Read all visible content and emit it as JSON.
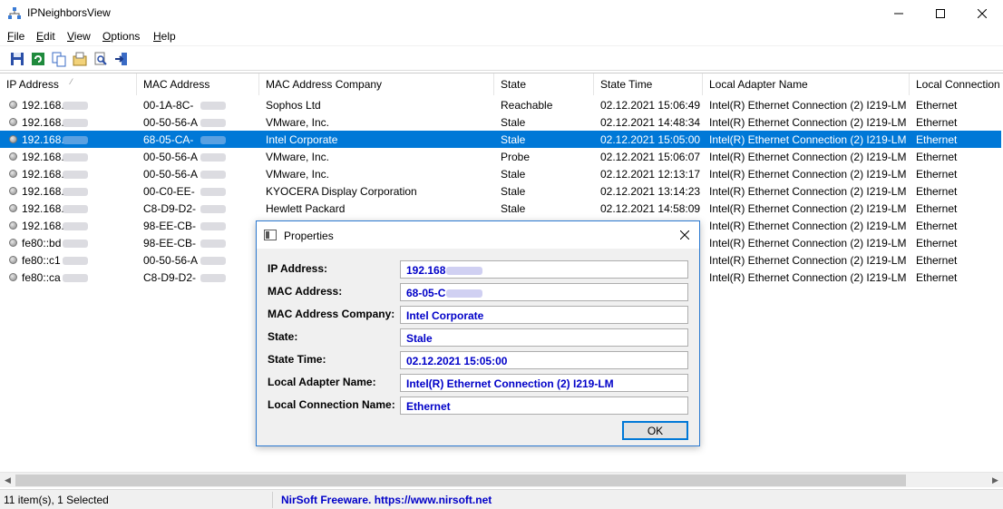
{
  "window": {
    "title": "IPNeighborsView"
  },
  "menu": [
    {
      "label": "File",
      "key": "F",
      "rest": "ile"
    },
    {
      "label": "Edit",
      "key": "E",
      "rest": "dit"
    },
    {
      "label": "View",
      "key": "V",
      "rest": "iew"
    },
    {
      "label": "Options",
      "key": "O",
      "rest": "ptions"
    },
    {
      "label": "Help",
      "key": "H",
      "rest": "elp"
    }
  ],
  "toolbar": [
    "save-icon",
    "refresh-icon",
    "copy-icon",
    "properties-icon",
    "find-icon",
    "exit-icon"
  ],
  "columns": [
    "IP Address",
    "MAC Address",
    "MAC Address Company",
    "State",
    "State Time",
    "Local Adapter Name",
    "Local Connection"
  ],
  "rows": [
    {
      "ip": "192.168.",
      "mac": "00-1A-8C-",
      "company": "Sophos Ltd",
      "state": "Reachable",
      "time": "02.12.2021 15:06:49",
      "adapter": "Intel(R) Ethernet Connection (2) I219-LM",
      "conn": "Ethernet"
    },
    {
      "ip": "192.168.",
      "mac": "00-50-56-A",
      "company": "VMware, Inc.",
      "state": "Stale",
      "time": "02.12.2021 14:48:34",
      "adapter": "Intel(R) Ethernet Connection (2) I219-LM",
      "conn": "Ethernet"
    },
    {
      "ip": "192.168.",
      "mac": "68-05-CA-",
      "company": "Intel Corporate",
      "state": "Stale",
      "time": "02.12.2021 15:05:00",
      "adapter": "Intel(R) Ethernet Connection (2) I219-LM",
      "conn": "Ethernet",
      "selected": true
    },
    {
      "ip": "192.168.",
      "mac": "00-50-56-A",
      "company": "VMware, Inc.",
      "state": "Probe",
      "time": "02.12.2021 15:06:07",
      "adapter": "Intel(R) Ethernet Connection (2) I219-LM",
      "conn": "Ethernet"
    },
    {
      "ip": "192.168.",
      "mac": "00-50-56-A",
      "company": "VMware, Inc.",
      "state": "Stale",
      "time": "02.12.2021 12:13:17",
      "adapter": "Intel(R) Ethernet Connection (2) I219-LM",
      "conn": "Ethernet"
    },
    {
      "ip": "192.168.",
      "mac": "00-C0-EE-",
      "company": "KYOCERA Display Corporation",
      "state": "Stale",
      "time": "02.12.2021 13:14:23",
      "adapter": "Intel(R) Ethernet Connection (2) I219-LM",
      "conn": "Ethernet"
    },
    {
      "ip": "192.168.",
      "mac": "C8-D9-D2-",
      "company": "Hewlett Packard",
      "state": "Stale",
      "time": "02.12.2021 14:58:09",
      "adapter": "Intel(R) Ethernet Connection (2) I219-LM",
      "conn": "Ethernet"
    },
    {
      "ip": "192.168.",
      "mac": "98-EE-CB-",
      "company": "",
      "state": "",
      "time": "",
      "adapter": "Intel(R) Ethernet Connection (2) I219-LM",
      "conn": "Ethernet"
    },
    {
      "ip": "fe80::bd",
      "mac": "98-EE-CB-",
      "company": "",
      "state": "",
      "time": "",
      "adapter": "Intel(R) Ethernet Connection (2) I219-LM",
      "conn": "Ethernet"
    },
    {
      "ip": "fe80::c1",
      "mac": "00-50-56-A",
      "company": "",
      "state": "",
      "time": "",
      "adapter": "Intel(R) Ethernet Connection (2) I219-LM",
      "conn": "Ethernet"
    },
    {
      "ip": "fe80::ca",
      "mac": "C8-D9-D2-",
      "company": "",
      "state": "",
      "time": "",
      "adapter": "Intel(R) Ethernet Connection (2) I219-LM",
      "conn": "Ethernet"
    }
  ],
  "status": {
    "count": "11 item(s), 1 Selected",
    "link": "NirSoft Freeware. https://www.nirsoft.net"
  },
  "dialog": {
    "title": "Properties",
    "fields": [
      {
        "label": "IP Address:",
        "value": "192.168"
      },
      {
        "label": "MAC Address:",
        "value": "68-05-C"
      },
      {
        "label": "MAC Address Company:",
        "value": "Intel Corporate"
      },
      {
        "label": "State:",
        "value": "Stale"
      },
      {
        "label": "State Time:",
        "value": "02.12.2021 15:05:00"
      },
      {
        "label": "Local Adapter Name:",
        "value": "Intel(R) Ethernet Connection (2) I219-LM"
      },
      {
        "label": "Local Connection Name:",
        "value": "Ethernet"
      }
    ],
    "ok_label": "OK"
  },
  "colors": {
    "selection": "#0078d7",
    "link": "#0000c8"
  }
}
